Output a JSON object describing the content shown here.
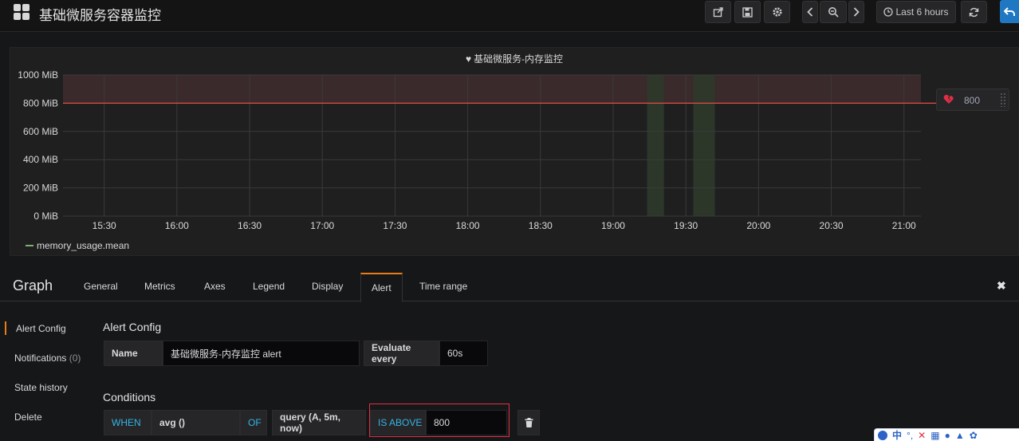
{
  "navbar": {
    "title": "基础微服务容器监控",
    "time_range": "Last 6 hours",
    "icons": [
      "share-icon",
      "save-icon",
      "gear-icon",
      "chevron-left-icon",
      "zoom-out-icon",
      "chevron-right-icon",
      "clock-icon",
      "refresh-icon",
      "back-icon"
    ]
  },
  "panel": {
    "title": "基础微服务-内存监控",
    "title_icon": "heart-icon",
    "legend_series": "memory_usage.mean",
    "threshold_handle_value": "800",
    "colors": {
      "threshold": "#e24d42",
      "series": "#7eb26d",
      "alert_region": "#3a2a2b"
    }
  },
  "chart_data": {
    "type": "line",
    "y_ticks": [
      "0 MiB",
      "200 MiB",
      "400 MiB",
      "600 MiB",
      "800 MiB",
      "1000 MiB"
    ],
    "x_ticks": [
      "15:30",
      "16:00",
      "16:30",
      "17:00",
      "17:30",
      "18:00",
      "18:30",
      "19:00",
      "19:30",
      "20:00",
      "20:30",
      "21:00"
    ],
    "ylim": [
      0,
      1000
    ],
    "x_range": [
      "15:13",
      "21:07"
    ],
    "threshold": 800,
    "grid": true,
    "series": [
      {
        "name": "memory_usage.mean",
        "values": []
      }
    ],
    "highlight_regions": [
      [
        "19:14",
        "19:21"
      ],
      [
        "19:33",
        "19:42"
      ]
    ]
  },
  "editor": {
    "title": "Graph",
    "tabs": [
      "General",
      "Metrics",
      "Axes",
      "Legend",
      "Display",
      "Alert",
      "Time range"
    ],
    "active_tab": "Alert"
  },
  "sidebar": {
    "items": [
      {
        "label": "Alert Config",
        "active": true
      },
      {
        "label": "Notifications",
        "count": "(0)"
      },
      {
        "label": "State history"
      },
      {
        "label": "Delete"
      }
    ]
  },
  "alert_config": {
    "heading": "Alert Config",
    "name_label": "Name",
    "name_value": "基础微服务-内存监控 alert",
    "eval_label": "Evaluate every",
    "eval_value": "60s"
  },
  "conditions": {
    "heading": "Conditions",
    "when": "WHEN",
    "func": "avg ()",
    "of": "OF",
    "query": "query (A, 5m, now)",
    "evaluator": "IS ABOVE",
    "threshold": "800"
  },
  "ime_bar": {
    "lang": "中"
  }
}
